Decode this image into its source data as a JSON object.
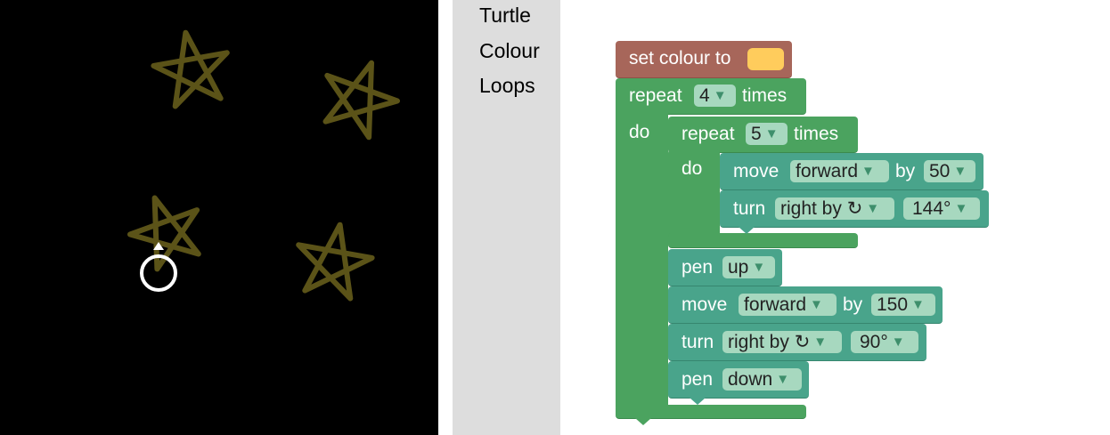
{
  "toolbox": {
    "categories": [
      "Turtle",
      "Colour",
      "Loops"
    ]
  },
  "blocks": {
    "set_colour": {
      "label": "set colour to",
      "color": "#ffcc5c"
    },
    "repeat_outer": {
      "label_pre": "repeat",
      "count": "4",
      "label_post": "times",
      "do": "do"
    },
    "repeat_inner": {
      "label_pre": "repeat",
      "count": "5",
      "label_post": "times",
      "do": "do"
    },
    "move_inner": {
      "label": "move",
      "direction": "forward",
      "by": "by",
      "distance": "50"
    },
    "turn_inner": {
      "label": "turn",
      "direction": "right by ↻",
      "angle": "144°"
    },
    "pen_up": {
      "label": "pen",
      "state": "up"
    },
    "move_outer": {
      "label": "move",
      "direction": "forward",
      "by": "by",
      "distance": "150"
    },
    "turn_outer": {
      "label": "turn",
      "direction": "right by ↻",
      "angle": "90°"
    },
    "pen_down": {
      "label": "pen",
      "state": "down"
    }
  },
  "colors": {
    "loop_block": "#4ba35f",
    "turtle_block": "#49a48b",
    "colour_block": "#a7665a",
    "star_stroke": "#5b5318",
    "canvas_bg": "#000000",
    "toolbox_bg": "#dddddd"
  },
  "icons": {
    "turtle": "turtle-cursor-icon",
    "dropdown": "dropdown-arrow-icon"
  }
}
